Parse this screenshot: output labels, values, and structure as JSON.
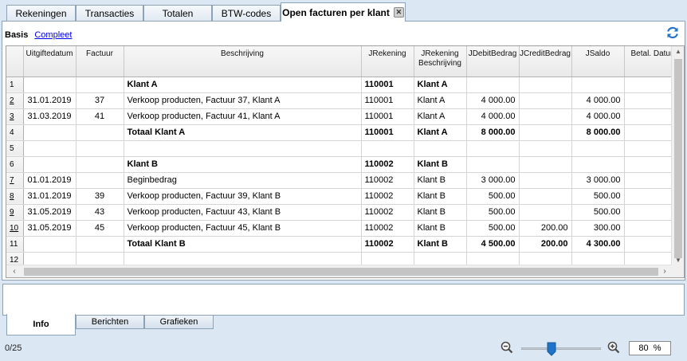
{
  "top_tabs": [
    {
      "label": "Rekeningen"
    },
    {
      "label": "Transacties"
    },
    {
      "label": "Totalen"
    },
    {
      "label": "BTW-codes"
    },
    {
      "label": "Open facturen per klant"
    }
  ],
  "view_bar": {
    "basis": "Basis",
    "compleet": "Compleet"
  },
  "table": {
    "columns": [
      "Uitgiftedatum",
      "Factuur",
      "Beschrijving",
      "JRekening",
      "JRekening\nBeschrijving",
      "JDebitBedrag",
      "JCreditBedrag",
      "JSaldo",
      "Betal. Datum"
    ],
    "rows": [
      {
        "n": "1",
        "date": "",
        "inv": "",
        "desc": "Klant A",
        "acc": "110001",
        "accdesc": "Klant A",
        "debit": "",
        "credit": "",
        "saldo": "",
        "bold": true,
        "link": false
      },
      {
        "n": "2",
        "date": "31.01.2019",
        "inv": "37",
        "desc": "Verkoop producten, Factuur 37, Klant A",
        "acc": "110001",
        "accdesc": "Klant A",
        "debit": "4 000.00",
        "credit": "",
        "saldo": "4 000.00",
        "bold": false,
        "link": true
      },
      {
        "n": "3",
        "date": "31.03.2019",
        "inv": "41",
        "desc": "Verkoop producten, Factuur 41, Klant A",
        "acc": "110001",
        "accdesc": "Klant A",
        "debit": "4 000.00",
        "credit": "",
        "saldo": "4 000.00",
        "bold": false,
        "link": true
      },
      {
        "n": "4",
        "date": "",
        "inv": "",
        "desc": "Totaal Klant A",
        "acc": "110001",
        "accdesc": "Klant A",
        "debit": "8 000.00",
        "credit": "",
        "saldo": "8 000.00",
        "bold": true,
        "link": false
      },
      {
        "n": "5",
        "date": "",
        "inv": "",
        "desc": "",
        "acc": "",
        "accdesc": "",
        "debit": "",
        "credit": "",
        "saldo": "",
        "bold": false,
        "link": false
      },
      {
        "n": "6",
        "date": "",
        "inv": "",
        "desc": "Klant B",
        "acc": "110002",
        "accdesc": "Klant B",
        "debit": "",
        "credit": "",
        "saldo": "",
        "bold": true,
        "link": false
      },
      {
        "n": "7",
        "date": "01.01.2019",
        "inv": "",
        "desc": "Beginbedrag",
        "acc": "110002",
        "accdesc": "Klant B",
        "debit": "3 000.00",
        "credit": "",
        "saldo": "3 000.00",
        "bold": false,
        "link": true
      },
      {
        "n": "8",
        "date": "31.01.2019",
        "inv": "39",
        "desc": "Verkoop producten, Factuur 39, Klant B",
        "acc": "110002",
        "accdesc": "Klant B",
        "debit": "500.00",
        "credit": "",
        "saldo": "500.00",
        "bold": false,
        "link": true
      },
      {
        "n": "9",
        "date": "31.05.2019",
        "inv": "43",
        "desc": "Verkoop producten, Factuur 43, Klant B",
        "acc": "110002",
        "accdesc": "Klant B",
        "debit": "500.00",
        "credit": "",
        "saldo": "500.00",
        "bold": false,
        "link": true
      },
      {
        "n": "10",
        "date": "31.05.2019",
        "inv": "45",
        "desc": "Verkoop producten, Factuur 45, Klant B",
        "acc": "110002",
        "accdesc": "Klant B",
        "debit": "500.00",
        "credit": "200.00",
        "saldo": "300.00",
        "bold": false,
        "link": true
      },
      {
        "n": "11",
        "date": "",
        "inv": "",
        "desc": "Totaal Klant B",
        "acc": "110002",
        "accdesc": "Klant B",
        "debit": "4 500.00",
        "credit": "200.00",
        "saldo": "4 300.00",
        "bold": true,
        "link": false
      },
      {
        "n": "12",
        "date": "",
        "inv": "",
        "desc": "",
        "acc": "",
        "accdesc": "",
        "debit": "",
        "credit": "",
        "saldo": "",
        "bold": false,
        "link": false
      }
    ]
  },
  "bottom_tabs": [
    {
      "label": "Info"
    },
    {
      "label": "Berichten"
    },
    {
      "label": "Grafieken"
    }
  ],
  "status": {
    "count": "0/25",
    "zoom": "80  %",
    "zoom_level": 0.38
  },
  "icons": {
    "refresh": "refresh-icon",
    "zoom_out": "zoom-out-icon",
    "zoom_in": "zoom-in-icon",
    "close": "close-icon"
  },
  "colors": {
    "accent": "#1f73c8",
    "link": "#0000ee",
    "window_bg": "#dbe7f3"
  }
}
